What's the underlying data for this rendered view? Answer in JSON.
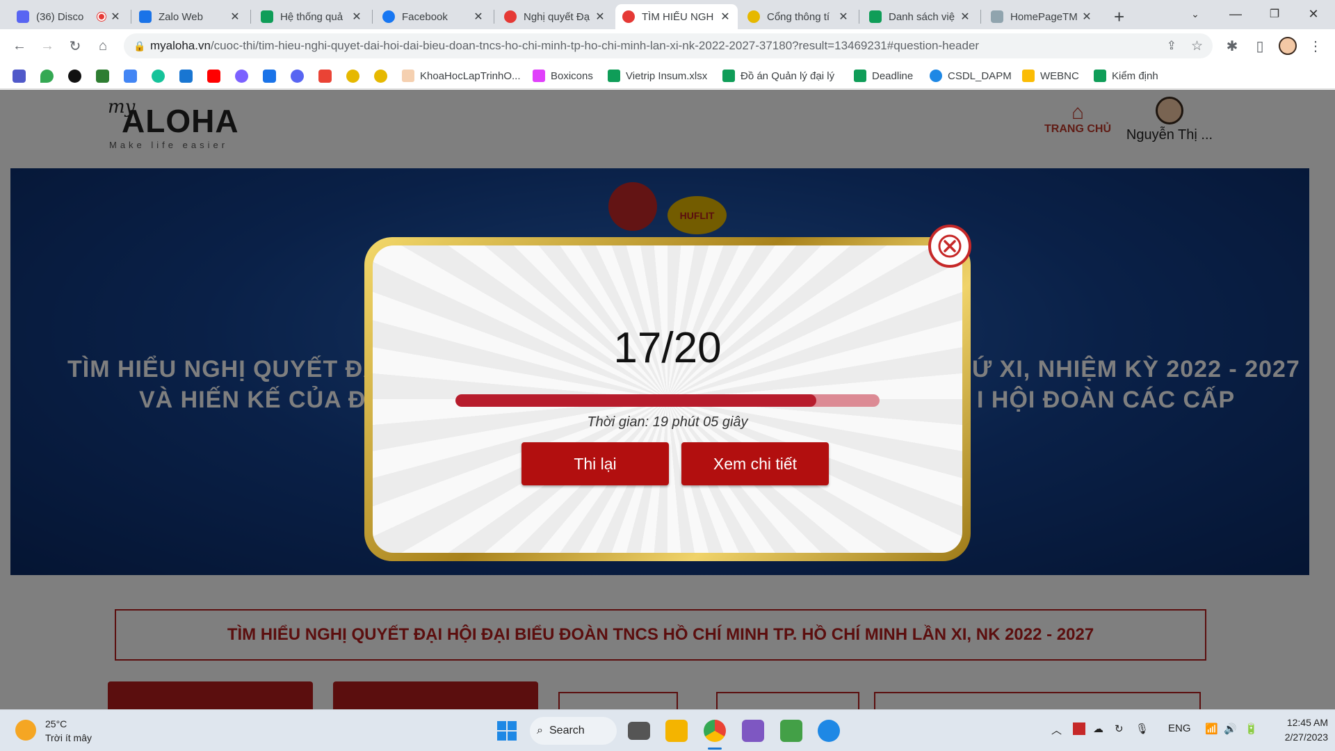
{
  "browser": {
    "tabs": [
      {
        "title": "(36) Disco",
        "color": "#5865f2"
      },
      {
        "title": "Zalo Web",
        "color": "#1a73e8"
      },
      {
        "title": "Hệ thống quả",
        "color": "#0f9d58"
      },
      {
        "title": "Facebook",
        "color": "#1877f2"
      },
      {
        "title": "Nghị quyết Đạ",
        "color": "#e53935"
      },
      {
        "title": "TÌM HIỂU NGH",
        "color": "#e53935"
      },
      {
        "title": "Cổng thông tí",
        "color": "#e6b800"
      },
      {
        "title": "Danh sách việ",
        "color": "#0f9d58"
      },
      {
        "title": "HomePageTM",
        "color": "#90a4ae"
      }
    ],
    "new_tab": "+",
    "url_host": "myaloha.vn",
    "url_rest": "/cuoc-thi/tim-hieu-nghi-quyet-dai-hoi-dai-bieu-doan-tncs-ho-chi-minh-tp-ho-chi-minh-lan-xi-nk-2022-2027-37180?result=13469231#question-header",
    "bookmarks": [
      {
        "label": "KhoaHocLapTrinhO...",
        "color": "#f5d0b0"
      },
      {
        "label": "Boxicons",
        "color": "#e040fb"
      },
      {
        "label": "Vietrip Insum.xlsx",
        "color": "#0f9d58"
      },
      {
        "label": "Đồ án Quản lý đại lý",
        "color": "#0f9d58"
      },
      {
        "label": "Deadline",
        "color": "#0f9d58"
      },
      {
        "label": "CSDL_DAPM",
        "color": "#1e88e5"
      },
      {
        "label": "WEBNC",
        "color": "#fbbc04"
      },
      {
        "label": "Kiểm định",
        "color": "#0f9d58"
      }
    ]
  },
  "site": {
    "logo_my": "my",
    "logo_main": "ALOHA",
    "logo_sub": "Make life easier",
    "home_label": "TRANG CHỦ",
    "user_name": "Nguyễn Thị ...",
    "banner_line1_left": "TÌM HIỂU NGHỊ QUYẾT ĐẠI HỘI",
    "banner_line1_right": "Ứ XI, NHIỆM KỲ 2022 - 2027",
    "banner_line2_left": "VÀ HIẾN KẾ CỦA ĐOÀN",
    "banner_line2_right": "I HỘI ĐOÀN CÁC CẤP",
    "seal_text": "HUFLIT",
    "contest_title": "TÌM HIỂU NGHỊ QUYẾT ĐẠI HỘI ĐẠI BIỂU ĐOÀN TNCS HỒ CHÍ MINH TP. HỒ CHÍ MINH LẦN XI, NK 2022 - 2027"
  },
  "result_modal": {
    "score": "17/20",
    "progress": 0.85,
    "time_text": "Thời gian: 19 phút 05 giây",
    "retry_label": "Thi lại",
    "detail_label": "Xem chi tiết"
  },
  "taskbar": {
    "weather_temp": "25°C",
    "weather_desc": "Trời ít mây",
    "search_label": "Search",
    "lang": "ENG",
    "time": "12:45 AM",
    "date": "2/27/2023"
  }
}
